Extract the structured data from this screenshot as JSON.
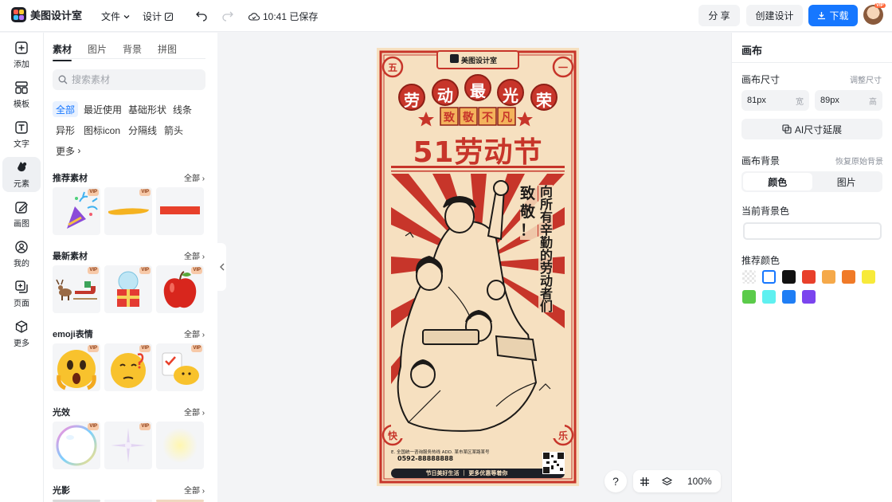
{
  "app": {
    "name": "美图设计室"
  },
  "topbar": {
    "menu_file": "文件",
    "menu_design": "设计",
    "save_time": "10:41 已保存",
    "share": "分 享",
    "create": "创建设计",
    "download": "下载",
    "avatar_badge": "VIP"
  },
  "rail": {
    "items": [
      {
        "label": "添加",
        "icon": "plus-square-icon"
      },
      {
        "label": "模板",
        "icon": "template-icon"
      },
      {
        "label": "文字",
        "icon": "text-icon"
      },
      {
        "label": "元素",
        "icon": "shapes-icon"
      },
      {
        "label": "画图",
        "icon": "pencil-icon"
      },
      {
        "label": "我的",
        "icon": "user-icon"
      },
      {
        "label": "页面",
        "icon": "page-icon"
      },
      {
        "label": "更多",
        "icon": "cube-icon"
      }
    ]
  },
  "assets": {
    "tabs": [
      "素材",
      "图片",
      "背景",
      "拼图"
    ],
    "search_placeholder": "搜索素材",
    "chips": [
      "全部",
      "最近使用",
      "基础形状",
      "线条",
      "异形",
      "图标icon",
      "分隔线",
      "箭头",
      "更多"
    ],
    "see_all": "全部",
    "vip": "VIP",
    "sections": [
      {
        "title": "推荐素材"
      },
      {
        "title": "最新素材"
      },
      {
        "title": "emoji表情"
      },
      {
        "title": "光效"
      },
      {
        "title": "光影"
      }
    ]
  },
  "poster": {
    "brand": "美图设计室",
    "corner_tl": "五",
    "corner_tr": "一",
    "corner_bl": "快",
    "corner_br": "乐",
    "headline_chars": [
      "劳",
      "动",
      "最",
      "光",
      "荣"
    ],
    "sub_chars": [
      "致",
      "敬",
      "不",
      "凡"
    ],
    "big_title": "51劳动节",
    "salute_chars": [
      "致",
      "敬",
      "！"
    ],
    "vertical_slogan": "向所有辛勤的劳动者们",
    "footer_line1": "E. 全国统一咨询服务热线   ADD.   某市某区某路某号",
    "footer_phone": "0592-88888888",
    "footer_bar": "节日美好生活 ｜ 更多优惠等着你"
  },
  "canvas": {
    "help": "?",
    "zoom": "100%"
  },
  "right": {
    "title": "画布",
    "size_label": "画布尺寸",
    "adjust_size": "调整尺寸",
    "width_value": "81px",
    "width_unit": "宽",
    "height_value": "89px",
    "height_unit": "高",
    "ai_extend": "AI尺寸延展",
    "bg_label": "画布背景",
    "restore_bg": "恢复原始背景",
    "seg_color": "颜色",
    "seg_image": "图片",
    "current_bg": "当前背景色",
    "recommend": "推荐颜色",
    "swatches": [
      "transparent",
      "#ffffff",
      "#111111",
      "#e8402b",
      "#f5a94a",
      "#f07a28",
      "#f7ea3a",
      "#5bcb4a",
      "#5ff0f0",
      "#1f7ef5",
      "#7b45ee"
    ]
  }
}
